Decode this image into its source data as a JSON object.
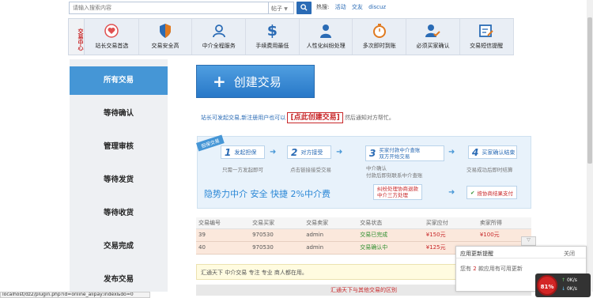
{
  "search": {
    "placeholder": "请输入搜索内容",
    "select_value": "帖子",
    "hot_label": "热搜:",
    "hot_links": [
      "活动",
      "交友",
      "discuz"
    ]
  },
  "catnav": {
    "label": "交易中心",
    "items": [
      {
        "label": "站长交易首选",
        "icon": "heart-badge-icon"
      },
      {
        "label": "交易安全高",
        "icon": "shield-icon"
      },
      {
        "label": "中介全程服务",
        "icon": "user-icon"
      },
      {
        "label": "手续费用最低",
        "icon": "dollar-icon"
      },
      {
        "label": "人性化纠纷处理",
        "icon": "person-icon"
      },
      {
        "label": "多次即时到账",
        "icon": "stopwatch-icon"
      },
      {
        "label": "必须买家确认",
        "icon": "user-check-icon"
      },
      {
        "label": "交易短信提醒",
        "icon": "message-edit-icon"
      }
    ]
  },
  "leftnav": {
    "items": [
      "所有交易",
      "等待确认",
      "管理审核",
      "等待发货",
      "等待收货",
      "交易完成",
      "发布交易"
    ],
    "active_index": 0
  },
  "main": {
    "create_label": "创建交易",
    "notice_prefix": "站长可发起交易,新注册用户也可以",
    "notice_link": "[点此创建交易]",
    "notice_suffix": "然后通知对方帮忙。"
  },
  "flow": {
    "ribbon": "担保交易",
    "steps": [
      {
        "num": "1",
        "label": "发起担保",
        "sub": "只需一方发起即可"
      },
      {
        "num": "2",
        "label": "对方接受",
        "sub": "点击链接接受交易"
      },
      {
        "num": "3",
        "label": "买家付款中介查账\n双方开始交易",
        "sub": "中介确认\n付款后即刻联系中介查账"
      },
      {
        "num": "4",
        "label": "买家确认结束",
        "sub": "交易成功后即时结算"
      }
    ],
    "slogan": "隐势力中介 安全 快捷 2%中介费",
    "dispute_label": "纠纷处理协商退款\n中介三方处理",
    "refund_label": "按协商结果支付"
  },
  "table": {
    "headers": [
      "交易编号",
      "交易买家",
      "交易卖家",
      "交易状态",
      "买家应付",
      "卖家所得"
    ],
    "rows": [
      [
        "39",
        "970530",
        "admin",
        "交易已完成",
        "¥150元",
        "¥100元"
      ],
      [
        "40",
        "970530",
        "admin",
        "交易确认中",
        "¥125元",
        ""
      ]
    ]
  },
  "info_bar": "汇通天下 中介交易 专注 专业 商人都在用。",
  "red_bar": "汇通天下与其他交易的区别",
  "popup": {
    "title": "应用更新提醒",
    "close_label": "关闭",
    "body_prefix": "您有",
    "count": "2",
    "body_suffix": "款应用有可用更新"
  },
  "netwidget": {
    "percent": "81%",
    "up": "0K/s",
    "down": "0K/s"
  },
  "status_url": "localhost/dz2/plugin.php?id=online_alipay:index&do=0"
}
